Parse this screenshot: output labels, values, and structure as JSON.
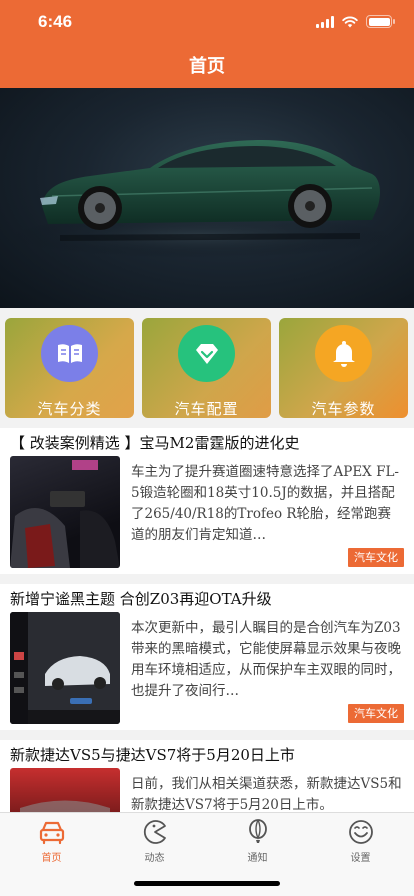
{
  "status_bar": {
    "time": "6:46"
  },
  "header": {
    "title": "首页"
  },
  "categories": [
    {
      "label": "汽车分类",
      "icon": "book-icon"
    },
    {
      "label": "汽车配置",
      "icon": "diamond-icon"
    },
    {
      "label": "汽车参数",
      "icon": "bell-icon"
    }
  ],
  "news": [
    {
      "title": "【 改装案例精选 】宝马M2雷霆版的进化史",
      "summary": "车主为了提升赛道圈速特意选择了APEX FL-5锻造轮圈和18英寸10.5J的数据，并且搭配了265/40/R18的Trofeo R轮胎，经常跑赛道的朋友们肯定知道…",
      "tag": "汽车文化"
    },
    {
      "title": "新增宁谧黑主题 合创Z03再迎OTA升级",
      "summary": "本次更新中，最引人瞩目的是合创汽车为Z03带来的黑暗模式，它能使屏幕显示效果与夜晚用车环境相适应，从而保护车主双眼的同时，也提升了夜间行…",
      "tag": "汽车文化"
    },
    {
      "title": "新款捷达VS5与捷达VS7将于5月20日上市",
      "summary": "日前，我们从相关渠道获悉，新款捷达VS5和新款捷达VS7将于5月20日上市。",
      "tag": ""
    }
  ],
  "tabbar": [
    {
      "label": "首页",
      "icon": "car-icon",
      "active": true
    },
    {
      "label": "动态",
      "icon": "pacman-icon",
      "active": false
    },
    {
      "label": "通知",
      "icon": "balloon-icon",
      "active": false
    },
    {
      "label": "设置",
      "icon": "smiley-icon",
      "active": false
    }
  ],
  "colors": {
    "accent": "#ec6a35",
    "tile_1": "#7b7fe8",
    "tile_2": "#26c27d",
    "tile_3": "#f5a623"
  }
}
